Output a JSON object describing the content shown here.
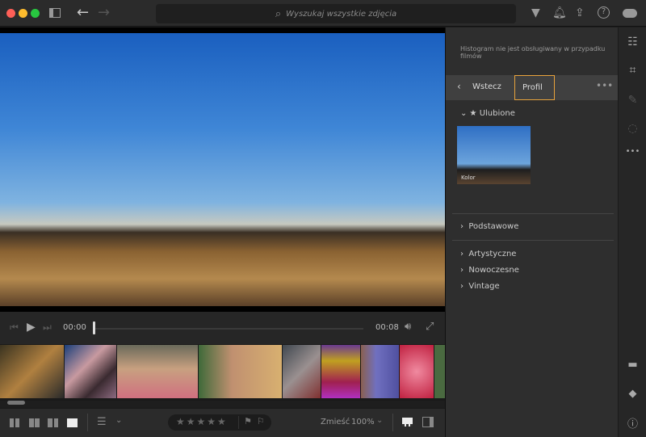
{
  "titlebar": {
    "search_placeholder": "Wyszukaj wszystkie zdjęcia"
  },
  "player": {
    "current_time": "00:00",
    "duration": "00:08",
    "progress": 0
  },
  "panel": {
    "histogram_msg": "Histogram nie jest obsługiwany w przypadku filmów",
    "back_label": "Wstecz",
    "tab_label": "Profil",
    "favorites_label": "Ulubione",
    "profile_thumb_label": "Kolor",
    "groups": [
      "Podstawowe",
      "Artystyczne",
      "Nowoczesne",
      "Vintage"
    ]
  },
  "bottombar": {
    "fit_label": "Zmieść",
    "zoom_value": "100%",
    "rating": 0
  },
  "colors": {
    "accent": "#e8a33c"
  }
}
